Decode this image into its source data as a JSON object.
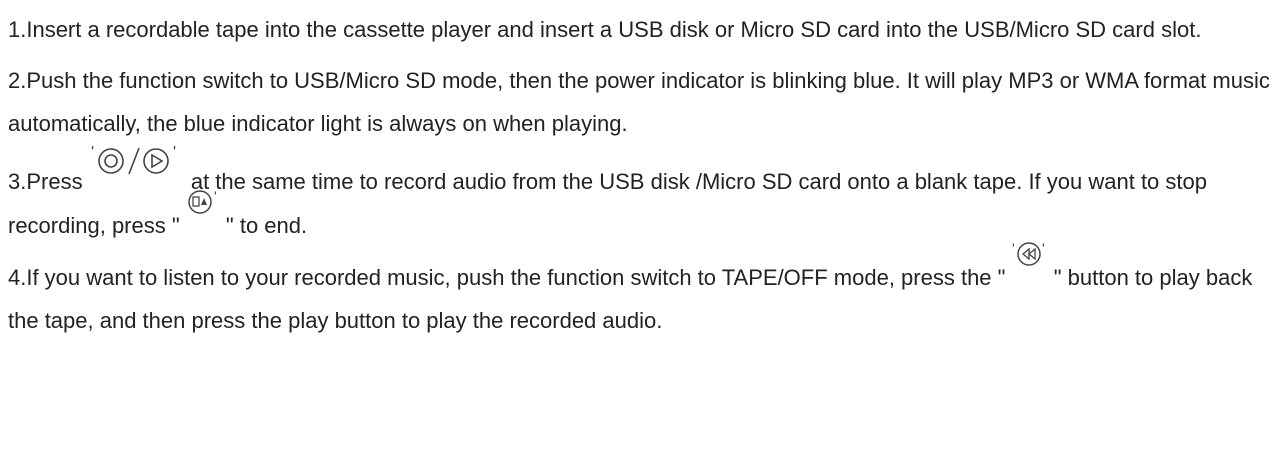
{
  "steps": [
    {
      "text": "1.Insert a recordable tape into the cassette player and insert a USB disk or Micro SD card into the USB/Micro SD card slot."
    },
    {
      "text": "2.Push the function switch to USB/Micro SD mode, then the power indicator is blinking blue. It will play MP3 or WMA format music automatically, the blue indicator light is always on when playing."
    },
    {
      "part1": "3.Press ",
      "icon_label": "'◎/▷'",
      "part2": " at the same time to record audio from the USB disk /Micro SD card onto a blank tape. If you want to stop recording, press \"",
      "part3": "\" to end.",
      "icons": [
        "record-icon",
        "play-icon",
        "stop-eject-icon"
      ]
    },
    {
      "part1": "4.If you want to listen to your recorded music, push the function switch to TAPE/OFF mode, press the \"",
      "part2": "\" button to play back the tape, and then press the play button to play the recorded audio.",
      "icons": [
        "rewind-icon"
      ]
    }
  ],
  "colors": {
    "text": "#222222",
    "icon": "#444444"
  }
}
